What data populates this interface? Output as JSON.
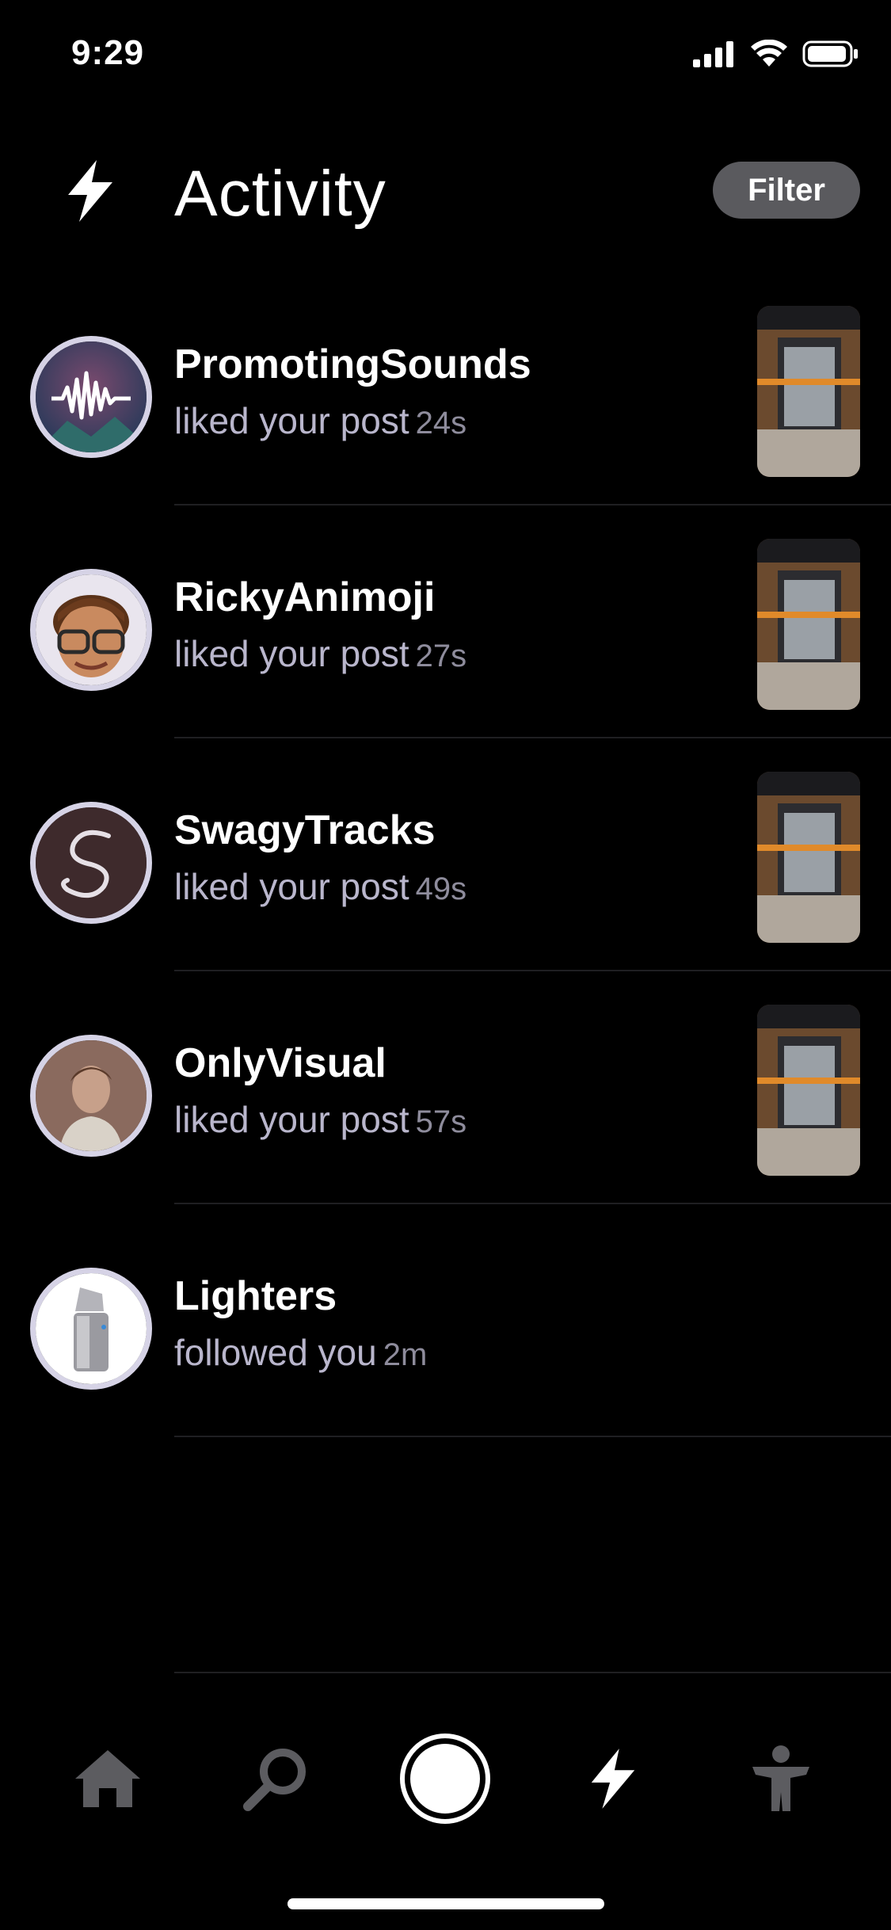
{
  "status_bar": {
    "time": "9:29"
  },
  "header": {
    "title": "Activity",
    "filter_label": "Filter"
  },
  "activities": [
    {
      "username": "PromotingSounds",
      "action": "liked your post",
      "time": "24s",
      "avatar_icon": "waveform-avatar",
      "has_thumbnail": true
    },
    {
      "username": "RickyAnimoji",
      "action": "liked your post",
      "time": "27s",
      "avatar_icon": "memoji-avatar",
      "has_thumbnail": true
    },
    {
      "username": "SwagyTracks",
      "action": "liked your post",
      "time": "49s",
      "avatar_icon": "script-s-avatar",
      "has_thumbnail": true
    },
    {
      "username": "OnlyVisual",
      "action": "liked your post",
      "time": "57s",
      "avatar_icon": "portrait-avatar",
      "has_thumbnail": true
    },
    {
      "username": "Lighters",
      "action": "followed you",
      "time": "2m",
      "avatar_icon": "lighter-avatar",
      "has_thumbnail": false
    }
  ],
  "tab_bar": {
    "items": [
      "home-icon",
      "search-icon",
      "record-icon",
      "bolt-icon",
      "profile-icon"
    ],
    "active": "bolt-icon"
  },
  "colors": {
    "background": "#000000",
    "secondary_text": "#b9b6cc",
    "avatar_ring": "#d6d3e6",
    "filter_bg": "#5a5a5e"
  }
}
